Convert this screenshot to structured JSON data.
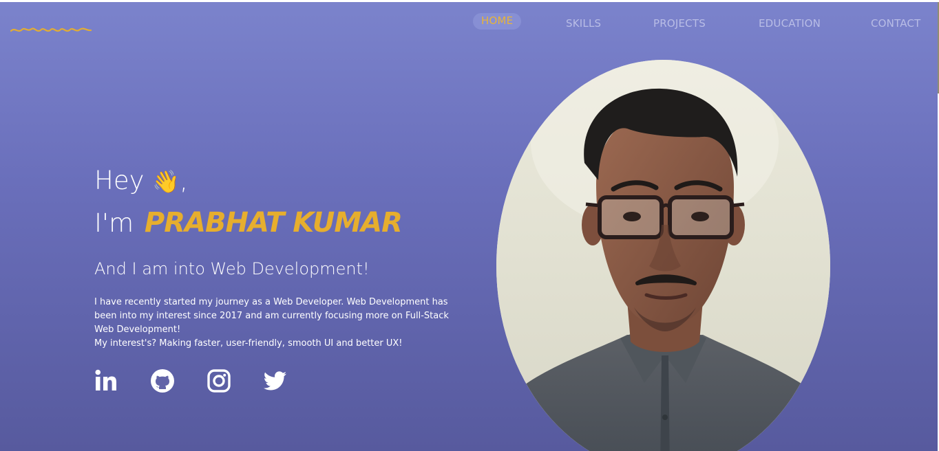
{
  "nav": {
    "items": [
      {
        "label": "HOME",
        "active": true
      },
      {
        "label": "SKILLS",
        "active": false
      },
      {
        "label": "PROJECTS",
        "active": false
      },
      {
        "label": "EDUCATION",
        "active": false
      },
      {
        "label": "CONTACT",
        "active": false
      }
    ]
  },
  "hero": {
    "greeting": "Hey",
    "wave_emoji": "👋",
    "greeting_suffix": ",",
    "intro_prefix": "I'm",
    "name": "Prabhat Kumar",
    "tagline": "And I am into Web Development!",
    "description_lines": [
      "I have recently started my journey as a Web Developer. Web Development has been into my interest since 2017 and am currently focusing more on Full-Stack Web Development!",
      "My interest's? Making faster, user-friendly, smooth UI and better UX!"
    ]
  },
  "socials": [
    {
      "icon": "linkedin-icon"
    },
    {
      "icon": "github-icon"
    },
    {
      "icon": "instagram-icon"
    },
    {
      "icon": "twitter-icon"
    }
  ],
  "colors": {
    "accent": "#e6ae2e",
    "nav_text": "#b9bde6",
    "background_top": "#7b83cc",
    "background_bottom": "#575a9e"
  }
}
